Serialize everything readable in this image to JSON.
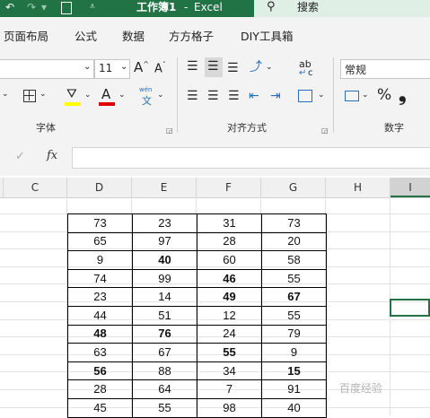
{
  "titlebar": {
    "save_glyph": "🖫",
    "filename": "工作簿1",
    "dash": "-",
    "app": "Excel",
    "search_placeholder": "搜索"
  },
  "menu": [
    "页面布局",
    "公式",
    "数据",
    "方方格子",
    "DIY工具箱"
  ],
  "ribbon": {
    "font_size": "11",
    "font_grow": "A",
    "font_shrink": "A",
    "number_format": "常规",
    "percent": "%",
    "comma": "❟",
    "groups": {
      "font": "字体",
      "alignment": "对齐方式",
      "number": "数字"
    },
    "wen": "wén",
    "wen2": "文",
    "abc": "ab",
    "abc2": "c"
  },
  "formula_bar": {
    "fx": "fx",
    "check": "✓"
  },
  "columns": [
    "C",
    "D",
    "E",
    "F",
    "G",
    "H",
    "I"
  ],
  "table": {
    "rows": [
      [
        {
          "v": "73"
        },
        {
          "v": "23"
        },
        {
          "v": "31"
        },
        {
          "v": "73"
        }
      ],
      [
        {
          "v": "65"
        },
        {
          "v": "97"
        },
        {
          "v": "28"
        },
        {
          "v": "20"
        }
      ],
      [
        {
          "v": "9"
        },
        {
          "v": "40",
          "b": true
        },
        {
          "v": "60"
        },
        {
          "v": "58"
        }
      ],
      [
        {
          "v": "74"
        },
        {
          "v": "99"
        },
        {
          "v": "46",
          "b": true
        },
        {
          "v": "55"
        }
      ],
      [
        {
          "v": "23"
        },
        {
          "v": "14"
        },
        {
          "v": "49",
          "b": true
        },
        {
          "v": "67",
          "b": true
        }
      ],
      [
        {
          "v": "44"
        },
        {
          "v": "51"
        },
        {
          "v": "12"
        },
        {
          "v": "55"
        }
      ],
      [
        {
          "v": "48",
          "b": true
        },
        {
          "v": "76",
          "b": true
        },
        {
          "v": "24"
        },
        {
          "v": "79"
        }
      ],
      [
        {
          "v": "63"
        },
        {
          "v": "67"
        },
        {
          "v": "55",
          "b": true
        },
        {
          "v": "9"
        }
      ],
      [
        {
          "v": "56",
          "b": true
        },
        {
          "v": "88"
        },
        {
          "v": "34"
        },
        {
          "v": "15",
          "b": true
        }
      ],
      [
        {
          "v": "28"
        },
        {
          "v": "64"
        },
        {
          "v": "7"
        },
        {
          "v": "91"
        }
      ],
      [
        {
          "v": "45"
        },
        {
          "v": "55"
        },
        {
          "v": "98"
        },
        {
          "v": "40"
        }
      ]
    ]
  },
  "watermark": "百度经验",
  "colors": {
    "excel_green": "#217346",
    "fill_yellow": "#ffff00",
    "font_red": "#e00000"
  }
}
